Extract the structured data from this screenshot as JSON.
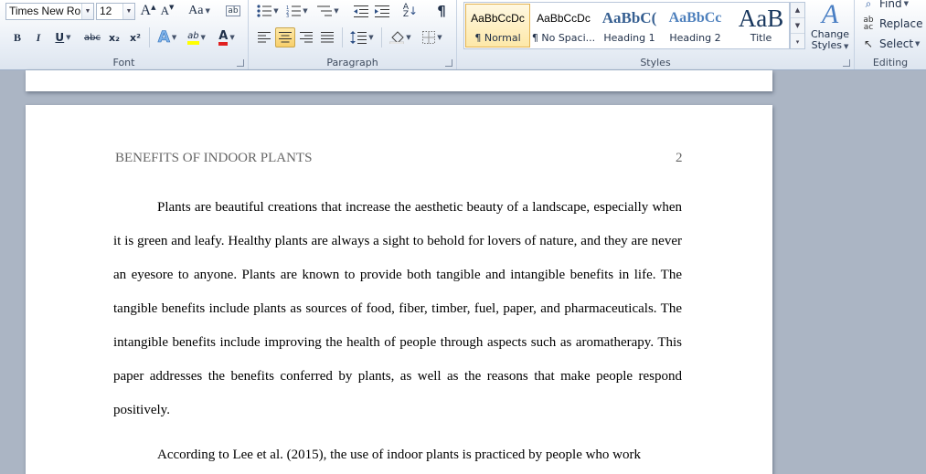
{
  "ribbon": {
    "font": {
      "name": "Times New Rom",
      "size": "12",
      "grow_icon": "A",
      "shrink_icon": "A",
      "change_case": "Aa",
      "bold": "B",
      "italic": "I",
      "underline": "U",
      "strikethrough": "abc",
      "subscript": "x₂",
      "superscript": "x²",
      "text_effects": "A",
      "highlight": "ab",
      "font_color": "A",
      "label": "Font"
    },
    "paragraph": {
      "label": "Paragraph",
      "pilcrow": "¶"
    },
    "styles": {
      "label": "Styles",
      "tiles": [
        {
          "sample": "AaBbCcDc",
          "name": "¶ Normal"
        },
        {
          "sample": "AaBbCcDc",
          "name": "¶ No Spaci..."
        },
        {
          "sample": "AaBbC(",
          "name": "Heading 1"
        },
        {
          "sample": "AaBbCc",
          "name": "Heading 2"
        },
        {
          "sample": "AaB",
          "name": "Title"
        }
      ],
      "change_styles": "Change Styles",
      "change_styles_line1": "Change",
      "change_styles_line2": "Styles"
    },
    "editing": {
      "label": "Editing",
      "find": "Find",
      "replace": "Replace",
      "select": "Select"
    }
  },
  "document": {
    "header_title": "BENEFITS OF INDOOR PLANTS",
    "page_number": "2",
    "paragraph1": "Plants are beautiful creations that increase the aesthetic beauty of a landscape, especially when it is green and leafy. Healthy plants are always a sight to behold for lovers of nature, and they are never an eyesore to anyone. Plants are known to provide both tangible and intangible benefits in life. The tangible benefits include plants as sources of food, fiber, timber, fuel, paper, and pharmaceuticals. The intangible benefits include improving the health of people through aspects such as aromatherapy. This paper addresses the benefits conferred by plants, as well as the reasons that make people respond positively.",
    "paragraph2": "According to Lee et al. (2015), the use of indoor plants is practiced by people who work"
  },
  "colors": {
    "highlight_yellow": "#ffff00",
    "font_red": "#e02020",
    "heading_blue": "#17365d",
    "heading2_blue": "#4f81bd",
    "title_color": "#17365d"
  }
}
